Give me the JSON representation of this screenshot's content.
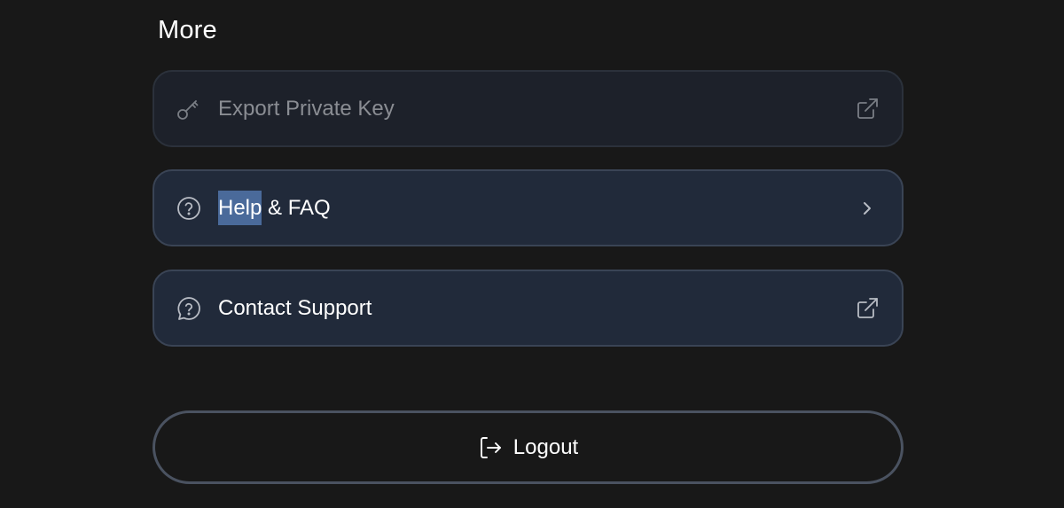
{
  "section": {
    "title": "More"
  },
  "items": [
    {
      "label": "Export Private Key",
      "icon": "key-icon",
      "trailing_icon": "external-link-icon",
      "disabled": true
    },
    {
      "label_highlighted": "Help",
      "label_rest": " & FAQ",
      "icon": "help-circle-icon",
      "trailing_icon": "chevron-right-icon"
    },
    {
      "label": "Contact Support",
      "icon": "chat-question-icon",
      "trailing_icon": "external-link-icon"
    }
  ],
  "logout": {
    "label": "Logout",
    "icon": "logout-icon"
  },
  "colors": {
    "background": "#181818",
    "item_background": "#212a3a",
    "item_border": "#3a4455",
    "logout_border": "#4a5260",
    "selection_highlight": "#4a6a9a"
  }
}
